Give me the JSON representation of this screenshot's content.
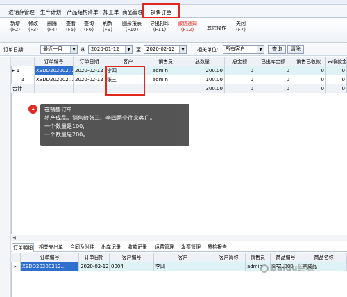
{
  "module_tabs": [
    "进销存管理",
    "生产计划",
    "产品结构清单",
    "加工单",
    "商品管理",
    "销售订单"
  ],
  "toolbar": [
    {
      "label": "新增",
      "key": "(F2)"
    },
    {
      "label": "修改",
      "key": "(F3)"
    },
    {
      "label": "删除",
      "key": "(F4)"
    },
    {
      "label": "查看",
      "key": "(F5)"
    },
    {
      "label": "查询",
      "key": "(F6)"
    },
    {
      "label": "刷新",
      "key": "(F9)"
    },
    {
      "label": "图形报表",
      "key": "(F10)"
    },
    {
      "label": "导出打印",
      "key": "(F11)"
    },
    {
      "label": "微信通知",
      "key": "(F12)"
    },
    {
      "label": "其它操作",
      "key": ""
    },
    {
      "label": "关闭",
      "key": "(F7)"
    }
  ],
  "filter": {
    "date_label": "订单日期:",
    "period": "最近一月",
    "from_label": "从",
    "from_date": "2020-01-12",
    "to_label": "至",
    "to_date": "2020-02-12",
    "unit_label": "相关单位:",
    "unit_value": "所有客户",
    "query_button": "查询",
    "clear_button": "清除"
  },
  "orders": {
    "columns": [
      "订单编号",
      "订单日期",
      "客户",
      "销售员",
      "总数量",
      "总金额",
      "已出库金额",
      "销售已收款",
      "未收款金"
    ],
    "rows": [
      {
        "index": "1",
        "order_no": "XSDD202002...",
        "date": "2020-02-12",
        "customer": "李四",
        "salesperson": "admin",
        "qty": "200.00",
        "amount": "0",
        "shipped": "0",
        "received": "0",
        "unpaid": "0"
      },
      {
        "index": "2",
        "order_no": "XSDD202002...",
        "date": "2020-02-12",
        "customer": "张三",
        "salesperson": "admin",
        "qty": "100.00",
        "amount": "0",
        "shipped": "0",
        "received": "0",
        "unpaid": "0"
      }
    ],
    "total": {
      "label": "合计",
      "qty": "300.00",
      "amount": "0",
      "shipped": "0",
      "received": "0",
      "unpaid": "0"
    }
  },
  "callout": {
    "badge": "1",
    "lines": [
      "在销售订单",
      "将产成品，销售给张三、李四两个往来客户。",
      "一个数量是100,",
      "一个数量是200。"
    ]
  },
  "detail_tabs": [
    "订单明细",
    "相关支出单",
    "合同及附件",
    "出库记录",
    "收款记录",
    "运费管理",
    "发票管理",
    "质检报告"
  ],
  "detail": {
    "columns": [
      "订单编号",
      "订单日期",
      "客户编号",
      "客户",
      "客户简称",
      "销售员",
      "商品编号",
      "商品名称"
    ],
    "rows": [
      {
        "order_no": "XSDD20200212...",
        "date": "2020-02-12",
        "cust_no": "0004",
        "customer": "李四",
        "short": "",
        "salesperson": "admin",
        "product_no": "SPZL000",
        "product": "产成品"
      }
    ]
  },
  "watermark": "Baidu经验"
}
